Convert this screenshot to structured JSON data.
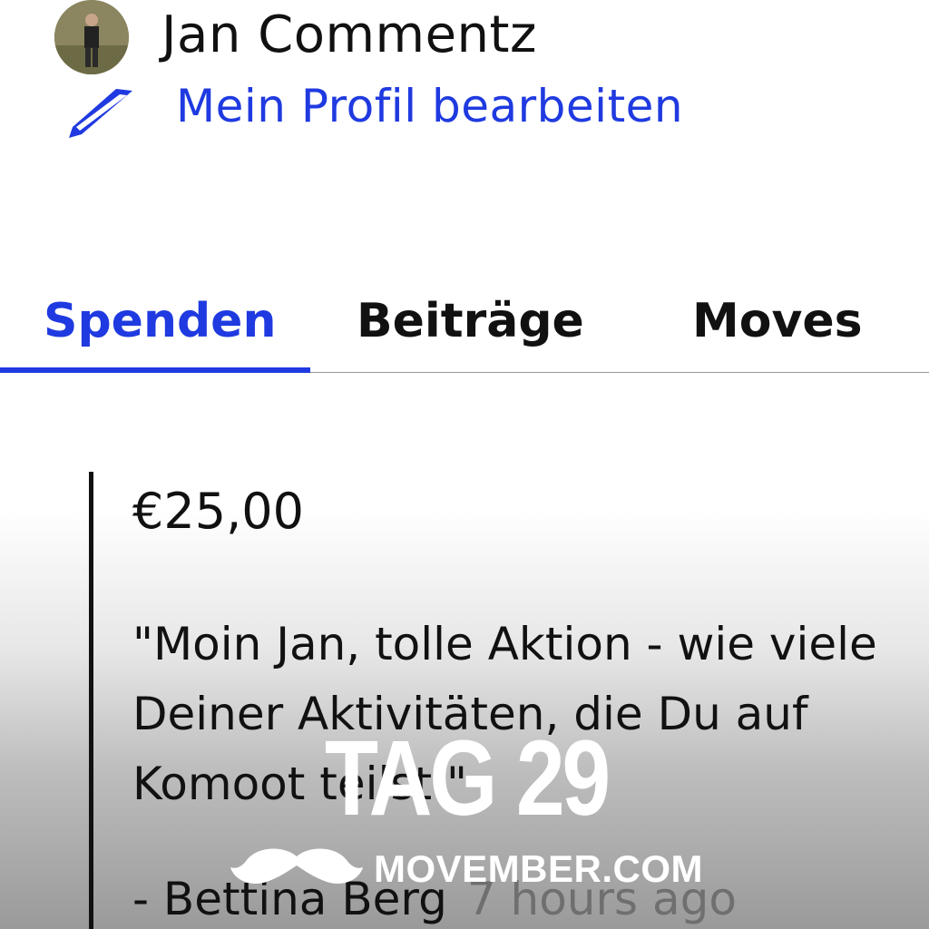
{
  "profile": {
    "name": "Jan Commentz",
    "edit_label": "Mein Profil bearbeiten",
    "edit_icon": "pencil-icon"
  },
  "tabs": [
    {
      "label": "Spenden",
      "active": true
    },
    {
      "label": "Beiträge",
      "active": false
    },
    {
      "label": "Moves",
      "active": false
    }
  ],
  "donation": {
    "amount": "€25,00",
    "message": "\"Moin Jan, tolle Aktion - wie viele Deiner Aktivitäten, die Du auf Komoot teilst \"",
    "donor": "- Bettina Berg",
    "time": "7 hours ago"
  },
  "overlay": {
    "day": "TAG 29",
    "brand": "MOVEMBER.COM",
    "brand_icon": "mustache-icon"
  },
  "colors": {
    "accent": "#1f3ae0",
    "text": "#111111",
    "muted": "#6f6f6f"
  }
}
